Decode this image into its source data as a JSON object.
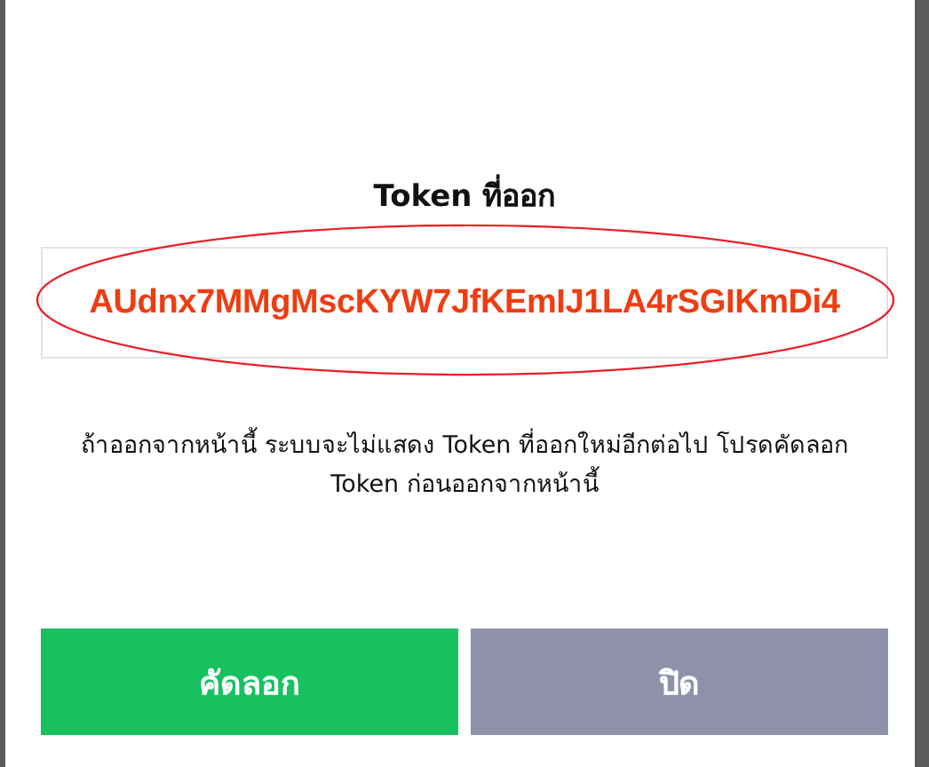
{
  "dialog": {
    "title": "Token ที่ออก",
    "token": "AUdnx7MMgMscKYW7JfKEmIJ1LA4rSGIKmDi4",
    "message": "ถ้าออกจากหน้านี้ ระบบจะไม่แสดง Token ที่ออกใหม่อีกต่อไป โปรดคัดลอก Token ก่อนออกจากหน้านี้",
    "buttons": [
      {
        "label": "คัดลอก",
        "kind": "primary"
      },
      {
        "label": "ปิด",
        "kind": "secondary"
      }
    ]
  }
}
